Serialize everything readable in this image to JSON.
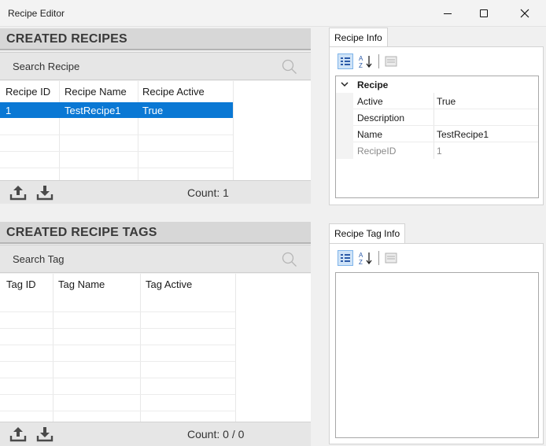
{
  "window": {
    "title": "Recipe Editor"
  },
  "recipes": {
    "heading": "CREATED RECIPES",
    "search_placeholder": "Search Recipe",
    "columns": [
      "Recipe ID",
      "Recipe Name",
      "Recipe Active"
    ],
    "rows": [
      {
        "id": "1",
        "name": "TestRecipe1",
        "active": "True"
      }
    ],
    "count": "Count: 1"
  },
  "tags": {
    "heading": "CREATED RECIPE TAGS",
    "search_placeholder": "Search Tag",
    "columns": [
      "Tag ID",
      "Tag Name",
      "Tag Active"
    ],
    "count": "Count: 0 / 0"
  },
  "recipe_info": {
    "tab": "Recipe Info",
    "category": "Recipe",
    "properties": [
      {
        "name": "Active",
        "value": "True"
      },
      {
        "name": "Description",
        "value": ""
      },
      {
        "name": "Name",
        "value": "TestRecipe1"
      },
      {
        "name": "RecipeID",
        "value": "1"
      }
    ]
  },
  "tag_info": {
    "tab": "Recipe Tag Info"
  },
  "colors": {
    "selection": "#0a78d4",
    "header_bg": "#d7d7d7",
    "toolbar_bg": "#e6e6e6"
  },
  "icons": [
    "minimize-icon",
    "maximize-icon",
    "close-icon",
    "search-icon",
    "upload-icon",
    "download-icon",
    "categorized-icon",
    "sort-alpha-icon",
    "property-pages-icon",
    "chevron-down-icon"
  ]
}
